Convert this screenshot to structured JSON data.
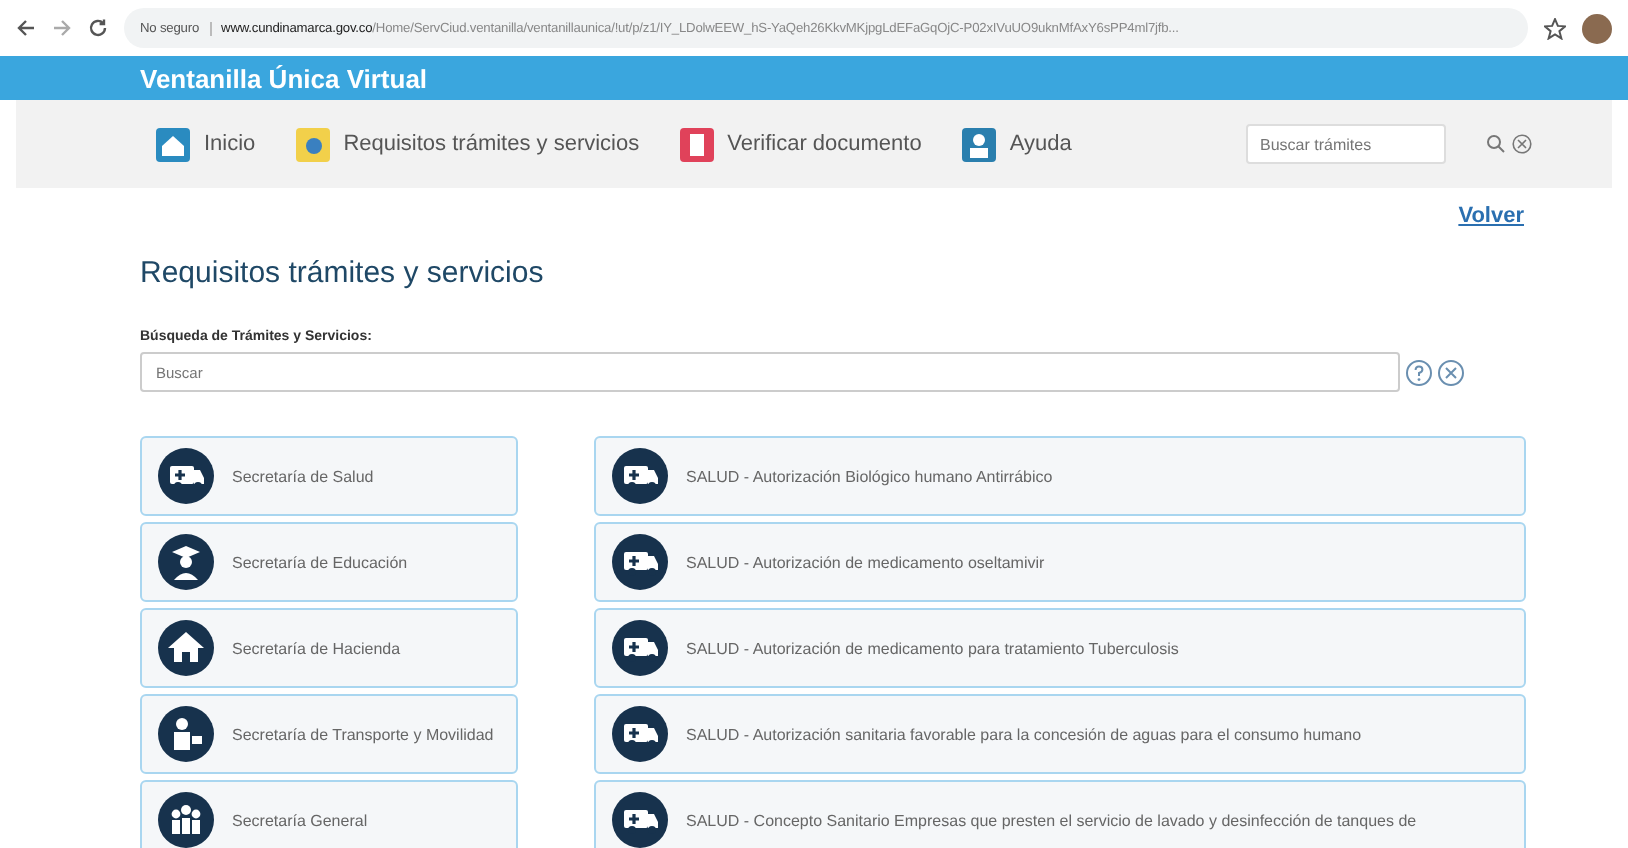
{
  "browser": {
    "security": "No seguro",
    "url_host": "www.cundinamarca.gov.co",
    "url_path": "/Home/ServCiud.ventanilla/ventanillaunica/!ut/p/z1/IY_LDolwEEW_hS-YaQeh26KkvMKjpgLdEFaGqOjC-P02xIVuUO9uknMfAxY6sPP4ml7jfb..."
  },
  "header": {
    "title": "Ventanilla Única Virtual"
  },
  "nav": [
    {
      "label": "Inicio",
      "kind": "home"
    },
    {
      "label": "Requisitos trámites y servicios",
      "kind": "hand"
    },
    {
      "label": "Verificar documento",
      "kind": "document"
    },
    {
      "label": "Ayuda",
      "kind": "help"
    }
  ],
  "nav_search": {
    "placeholder": "Buscar trámites"
  },
  "back_link": "Volver",
  "page_title": "Requisitos trámites y servicios",
  "search": {
    "label": "Búsqueda de Trámites y Servicios:",
    "placeholder": "Buscar"
  },
  "secretarias": [
    {
      "label": "Secretaría de Salud",
      "kind": "ambulance"
    },
    {
      "label": "Secretaría de Educación",
      "kind": "graduate"
    },
    {
      "label": "Secretaría de Hacienda",
      "kind": "house"
    },
    {
      "label": "Secretaría de Transporte y Movilidad",
      "kind": "person"
    },
    {
      "label": "Secretaría General",
      "kind": "people"
    }
  ],
  "tramites": [
    {
      "label": "SALUD - Autorización Biológico humano Antirrábico"
    },
    {
      "label": "SALUD - Autorización de medicamento oseltamivir"
    },
    {
      "label": "SALUD - Autorización de medicamento para tratamiento Tuberculosis"
    },
    {
      "label": "SALUD - Autorización sanitaria favorable para la concesión de aguas para el consumo humano"
    },
    {
      "label": "SALUD - Concepto Sanitario Empresas que presten el servicio de lavado y desinfección de tanques de"
    }
  ]
}
